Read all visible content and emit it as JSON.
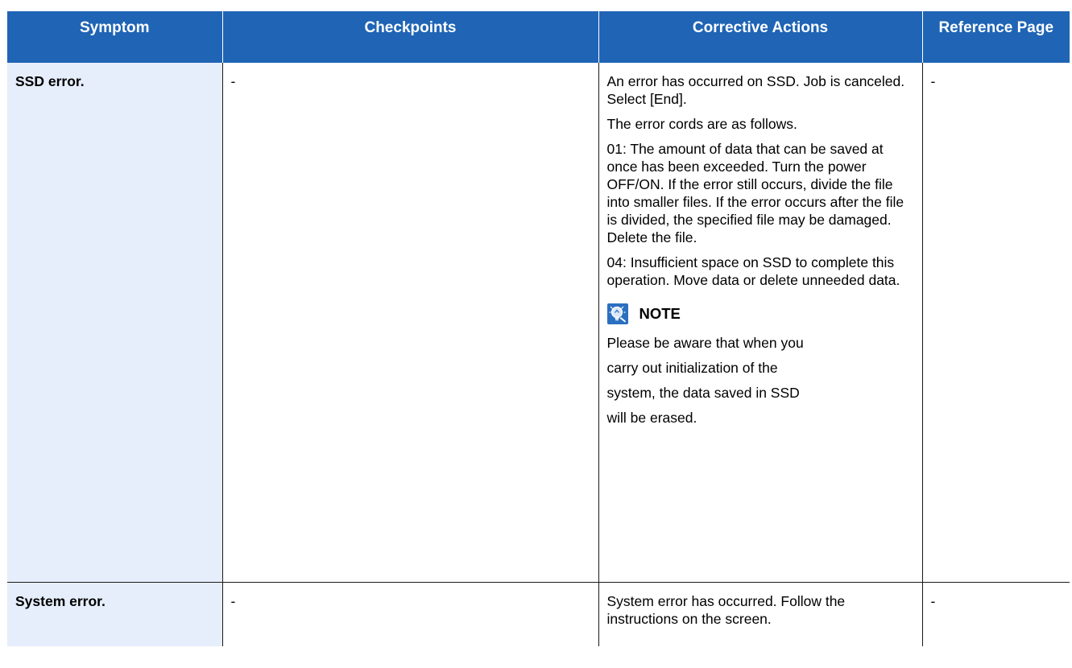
{
  "table": {
    "headers": [
      "Symptom",
      "Checkpoints",
      "Corrective Actions",
      "Reference Page"
    ],
    "header_color": "#1f64b5",
    "symptom_bg_color": "#e6edfb",
    "rows": [
      {
        "symptom": "SSD error.",
        "checkpoints": "-",
        "actions": [
          "An error has occurred on SSD. Job is canceled. Select [End].",
          "The error cords are as follows.",
          "01: The amount of data that can be saved at once has been exceeded. Turn the power OFF/ON. If the error still occurs, divide the file into smaller files. If the error occurs after the file is divided, the specified file may be damaged. Delete the file.",
          "04: Insufficient space on SSD to complete this operation. Move data or delete unneeded data."
        ],
        "note": {
          "icon": "note-icon",
          "label": "NOTE",
          "lines": [
            "Please be aware that when you",
            "carry out initialization of the",
            "system, the data saved in SSD",
            "will be erased."
          ]
        },
        "reference": "-"
      },
      {
        "symptom": "System error.",
        "checkpoints": "-",
        "actions": [
          "System error has occurred. Follow the instructions on the screen."
        ],
        "reference": "-"
      }
    ]
  }
}
